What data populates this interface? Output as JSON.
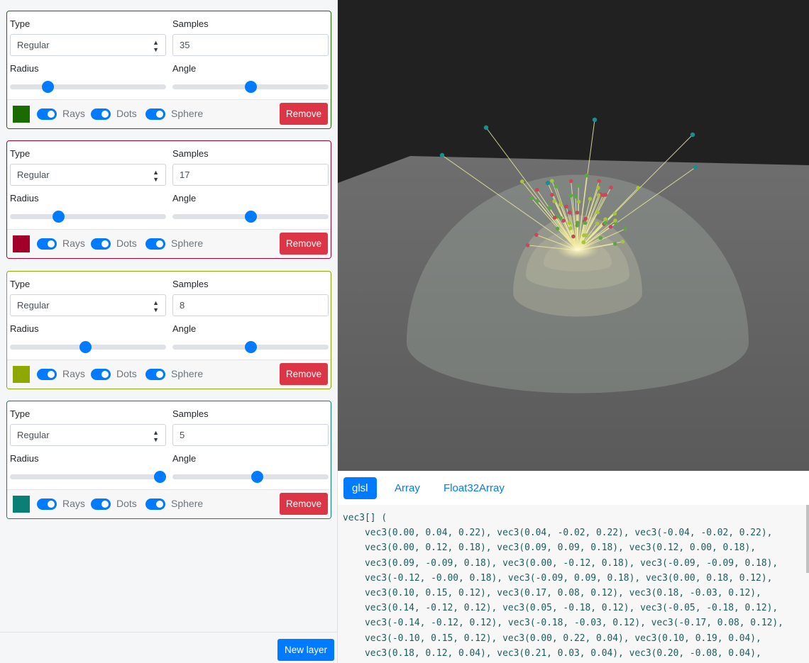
{
  "layers": [
    {
      "type_label": "Type",
      "type_value": "Regular",
      "samples_label": "Samples",
      "samples": "35",
      "radius_label": "Radius",
      "radius": 0.24,
      "angle_label": "Angle",
      "angle": 0.5,
      "color": "#1a6b00",
      "rays": "Rays",
      "dots": "Dots",
      "sphere": "Sphere",
      "remove": "Remove"
    },
    {
      "type_label": "Type",
      "type_value": "Regular",
      "samples_label": "Samples",
      "samples": "17",
      "radius_label": "Radius",
      "radius": 0.31,
      "angle_label": "Angle",
      "angle": 0.5,
      "color": "#a0002a",
      "rays": "Rays",
      "dots": "Dots",
      "sphere": "Sphere",
      "remove": "Remove"
    },
    {
      "type_label": "Type",
      "type_value": "Regular",
      "samples_label": "Samples",
      "samples": "8",
      "radius_label": "Radius",
      "radius": 0.48,
      "angle_label": "Angle",
      "angle": 0.5,
      "color": "#8fa800",
      "rays": "Rays",
      "dots": "Dots",
      "sphere": "Sphere",
      "remove": "Remove"
    },
    {
      "type_label": "Type",
      "type_value": "Regular",
      "samples_label": "Samples",
      "samples": "5",
      "radius_label": "Radius",
      "radius": 0.96,
      "angle_label": "Angle",
      "angle": 0.54,
      "color": "#0a8075",
      "rays": "Rays",
      "dots": "Dots",
      "sphere": "Sphere",
      "remove": "Remove"
    }
  ],
  "new_layer": "New layer",
  "tabs": [
    "glsl",
    "Array",
    "Float32Array"
  ],
  "active_tab": "glsl",
  "code_lines": [
    "vec3[] (",
    "    vec3(0.00, 0.04, 0.22), vec3(0.04, -0.02, 0.22), vec3(-0.04, -0.02, 0.22),",
    "    vec3(0.00, 0.12, 0.18), vec3(0.09, 0.09, 0.18), vec3(0.12, 0.00, 0.18),",
    "    vec3(0.09, -0.09, 0.18), vec3(0.00, -0.12, 0.18), vec3(-0.09, -0.09, 0.18),",
    "    vec3(-0.12, -0.00, 0.18), vec3(-0.09, 0.09, 0.18), vec3(0.00, 0.18, 0.12),",
    "    vec3(0.10, 0.15, 0.12), vec3(0.17, 0.08, 0.12), vec3(0.18, -0.03, 0.12),",
    "    vec3(0.14, -0.12, 0.12), vec3(0.05, -0.18, 0.12), vec3(-0.05, -0.18, 0.12),",
    "    vec3(-0.14, -0.12, 0.12), vec3(-0.18, -0.03, 0.12), vec3(-0.17, 0.08, 0.12),",
    "    vec3(-0.10, 0.15, 0.12), vec3(0.00, 0.22, 0.04), vec3(0.10, 0.19, 0.04),",
    "    vec3(0.18, 0.12, 0.04), vec3(0.21, 0.03, 0.04), vec3(0.20, -0.08, 0.04),"
  ]
}
